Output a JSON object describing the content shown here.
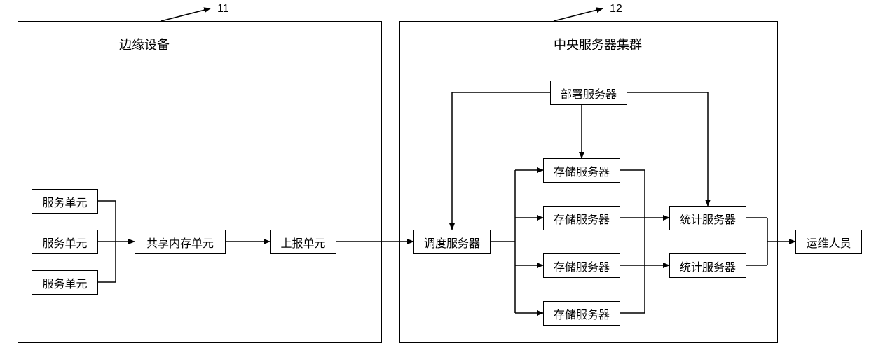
{
  "refs": {
    "left": "11",
    "right": "12"
  },
  "containers": {
    "left_title": "边缘设备",
    "right_title": "中央服务器集群"
  },
  "left": {
    "service_units": [
      "服务单元",
      "服务单元",
      "服务单元"
    ],
    "shared_mem": "共享内存单元",
    "report": "上报单元"
  },
  "right": {
    "dispatch": "调度服务器",
    "deploy": "部署服务器",
    "storage": [
      "存储服务器",
      "存储服务器",
      "存储服务器",
      "存储服务器"
    ],
    "stats": [
      "统计服务器",
      "统计服务器"
    ]
  },
  "ops": "运维人员"
}
